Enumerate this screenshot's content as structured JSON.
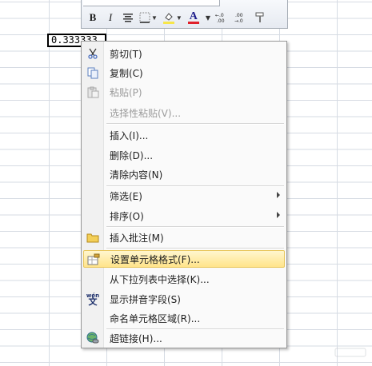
{
  "cell": {
    "value": "0.333333"
  },
  "mini_toolbar": {
    "bold_label": "B",
    "italic_label": "I",
    "font_color_label": "A"
  },
  "menu": {
    "cut": "剪切(T)",
    "copy": "复制(C)",
    "paste": "粘贴(P)",
    "paste_special": "选择性粘贴(V)...",
    "insert": "插入(I)...",
    "delete": "删除(D)...",
    "clear_contents": "清除内容(N)",
    "filter": "筛选(E)",
    "sort": "排序(O)",
    "insert_comment": "插入批注(M)",
    "format_cells": "设置单元格格式(F)...",
    "pick_from_list": "从下拉列表中选择(K)...",
    "phonetic": "显示拼音字段(S)",
    "define_name": "命名单元格区域(R)...",
    "hyperlink": "超链接(H)..."
  },
  "phonetic_icon_text": "wén",
  "phonetic_icon_char": "文",
  "colors": {
    "font_color_bar": "#e0202a",
    "fill_color_bar": "#f7e64a",
    "highlight": "#ffe48a"
  }
}
